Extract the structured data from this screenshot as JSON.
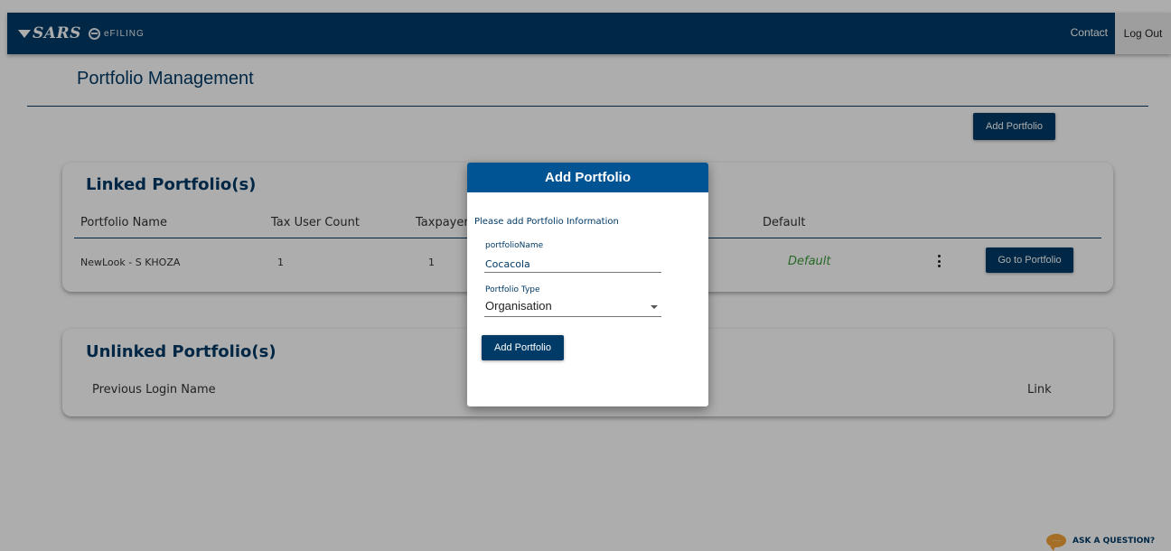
{
  "header": {
    "brand": "SARS",
    "efiling_label": "eFILING",
    "contact_label": "Contact",
    "logout_label": "Log Out",
    "colors": {
      "brand_navy": "#003a66",
      "accent_blue": "#005494"
    }
  },
  "page": {
    "title": "Portfolio Management",
    "add_portfolio_label": "Add Portfolio"
  },
  "linked": {
    "title": "Linked Portfolio(s)",
    "columns": [
      "Portfolio Name",
      "Tax User Count",
      "Taxpayer",
      "Default"
    ],
    "rows": [
      {
        "portfolio_name": "NewLook - S KHOZA",
        "tax_user_count": "1",
        "taxpayer": "1",
        "default": "Default",
        "action_label": "Go to Portfolio"
      }
    ]
  },
  "unlinked": {
    "title": "Unlinked Portfolio(s)",
    "columns": [
      "Previous Login Name",
      "Link"
    ]
  },
  "modal": {
    "title": "Add Portfolio",
    "subtitle": "Please add Portfolio Information",
    "name_label": "portfolioName",
    "name_value": "Cocacola",
    "type_label": "Portfolio Type",
    "type_value": "Organisation",
    "submit_label": "Add Portfolio"
  },
  "help": {
    "label": "ASK A QUESTION?",
    "icon": "chat-bubble-icon"
  }
}
